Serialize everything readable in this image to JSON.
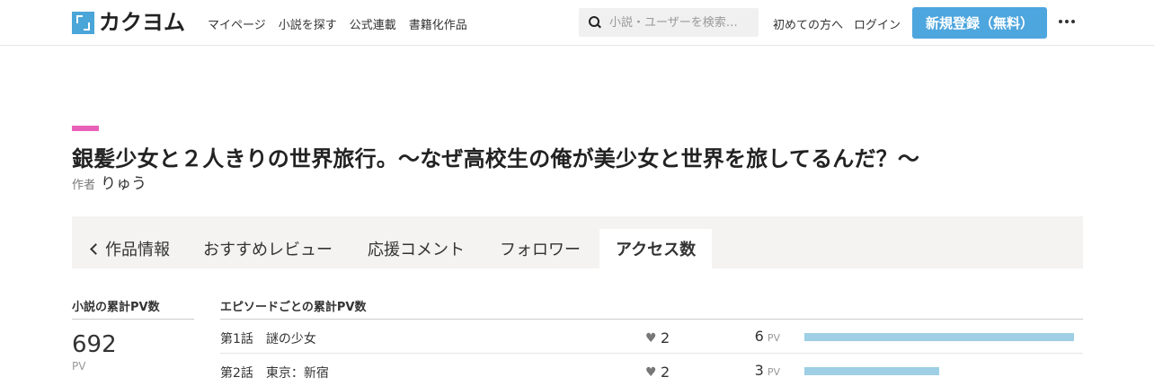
{
  "header": {
    "logo_text": "カクヨム",
    "nav": [
      "マイページ",
      "小説を探す",
      "公式連載",
      "書籍化作品"
    ],
    "search_placeholder": "小説・ユーザーを検索…",
    "first_time": "初めての方へ",
    "login": "ログイン",
    "signup": "新規登録（無料）"
  },
  "work": {
    "title": "銀髪少女と２人きりの世界旅行。〜なぜ高校生の俺が美少女と世界を旅してるんだ？〜",
    "author_label": "作者",
    "author_name": "りゅう"
  },
  "tabs": [
    "作品情報",
    "おすすめレビュー",
    "応援コメント",
    "フォロワー",
    "アクセス数"
  ],
  "active_tab": "アクセス数",
  "stats": {
    "total_heading": "小説の累計PV数",
    "total_pv": "692",
    "pv_unit": "PV",
    "episodes_heading": "エピソードごとの累計PV数",
    "episodes": [
      {
        "title": "第1話　謎の少女",
        "hearts": "2",
        "pv": "6",
        "pv_unit": "PV",
        "pv_value": 6
      },
      {
        "title": "第2話　東京：新宿",
        "hearts": "2",
        "pv": "3",
        "pv_unit": "PV",
        "pv_value": 3
      }
    ]
  },
  "colors": {
    "accent_blue": "#4ea6de",
    "title_accent_pink": "#e960b8",
    "bar": "#9ecfe5"
  }
}
